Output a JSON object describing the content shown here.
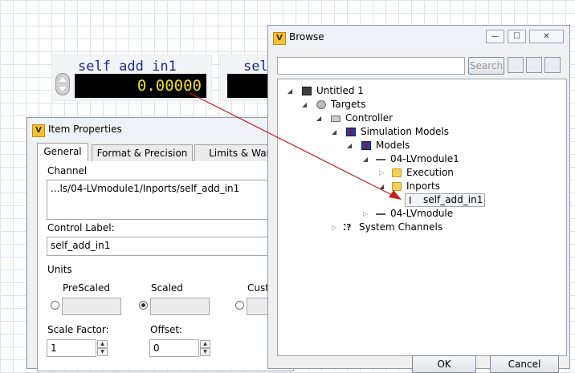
{
  "front_panel": {
    "control1": {
      "label": "self add in1",
      "value": "0.00000"
    },
    "control2": {
      "label": "sel"
    }
  },
  "item_properties": {
    "title": "Item Properties",
    "tabs": [
      {
        "label": "General",
        "active": true
      },
      {
        "label": "Format & Precision",
        "active": false
      },
      {
        "label": "Limits & Warn",
        "active": false
      }
    ],
    "channel_label": "Channel",
    "channel_value": "...ls/04-LVmodule1/Inports/self_add_in1",
    "control_label_label": "Control Label:",
    "control_label_value": "self_add_in1",
    "units_label": "Units",
    "units_options": [
      {
        "label": "PreScaled",
        "checked": false
      },
      {
        "label": "Scaled",
        "checked": true
      },
      {
        "label": "Cust",
        "checked": false
      }
    ],
    "scale_factor_label": "Scale Factor:",
    "scale_factor_value": "1",
    "offset_label": "Offset:",
    "offset_value": "0"
  },
  "browse": {
    "title": "Browse",
    "search_button": "Search",
    "search_value": "",
    "tree": [
      {
        "label": "Untitled 1",
        "icon": "cube-icon"
      },
      {
        "label": "Targets",
        "icon": "targets-icon"
      },
      {
        "label": "Controller",
        "icon": "controller-icon"
      },
      {
        "label": "Simulation Models",
        "icon": "model-icon"
      },
      {
        "label": "Models",
        "icon": "model-icon"
      },
      {
        "label": "04-LVmodule1",
        "icon": "module-icon"
      },
      {
        "label": "Execution",
        "icon": "folder-icon"
      },
      {
        "label": "Inports",
        "icon": "folder-icon"
      },
      {
        "label": "self_add_in1",
        "icon": "channel-icon"
      },
      {
        "label": "04-LVmodule",
        "icon": "module-icon"
      },
      {
        "label": "System Channels",
        "icon": "system-channels-icon"
      }
    ],
    "ok_button": "OK",
    "cancel_button": "Cancel"
  },
  "colors": {
    "accent": "#1a2a9a",
    "value_text": "#f0e020",
    "arrow": "#c82020"
  }
}
